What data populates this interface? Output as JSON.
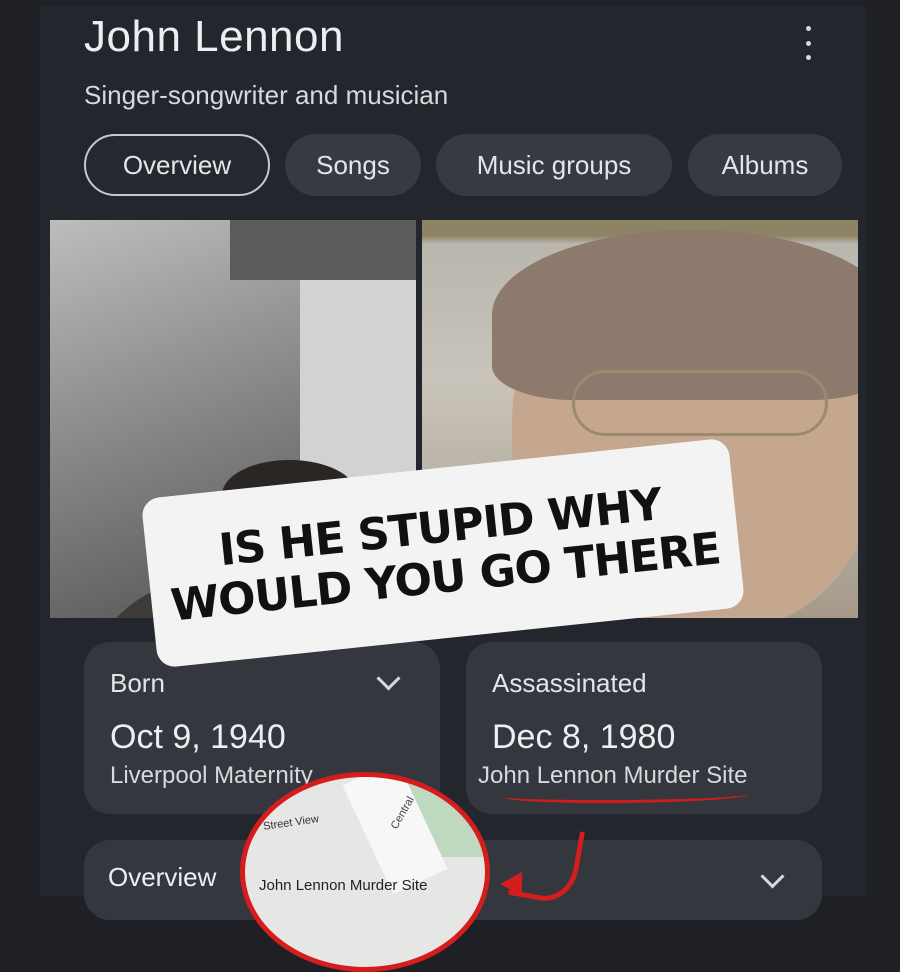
{
  "header": {
    "title": "John Lennon",
    "subtitle": "Singer-songwriter and musician"
  },
  "tabs": [
    {
      "label": "Overview",
      "active": true
    },
    {
      "label": "Songs",
      "active": false
    },
    {
      "label": "Music groups",
      "active": false
    },
    {
      "label": "Albums",
      "active": false
    }
  ],
  "overlay": {
    "caption_line1": "IS HE STUPID WHY",
    "caption_line2": "WOULD YOU GO THERE",
    "map_inset": {
      "street_view_label": "Street View",
      "road_label": "Central",
      "pin_label": "John Lennon Murder Site"
    }
  },
  "cards": {
    "born": {
      "label": "Born",
      "date": "Oct 9, 1940",
      "place": "Liverpool Maternity"
    },
    "assassinated": {
      "label": "Assassinated",
      "date": "Dec 8, 1980",
      "place": "John Lennon Murder Site"
    },
    "overview": {
      "label": "Overview"
    }
  },
  "colors": {
    "background": "#24262d",
    "card": "#35373f",
    "annotation_red": "#d51d1d"
  }
}
